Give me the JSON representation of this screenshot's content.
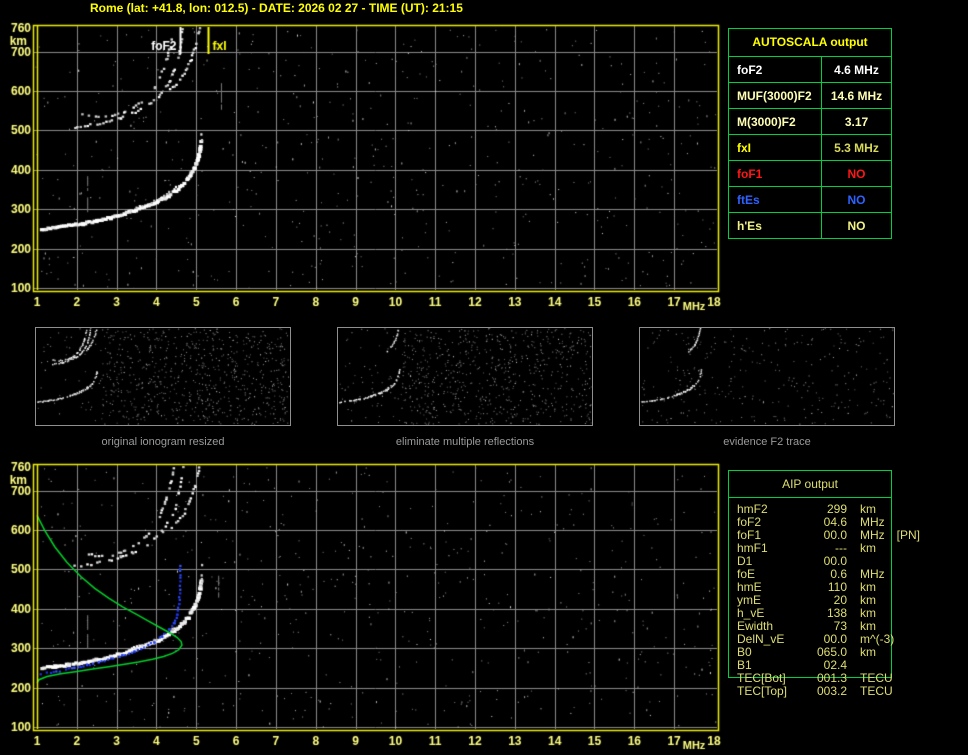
{
  "title": "Rome (lat: +41.8, lon: 012.5) - DATE: 2026 02 27 - TIME (UT): 21:15",
  "colors": {
    "background": "#000000",
    "title_yellow": "#ffff00",
    "axis_yellow": "#ffff80",
    "plot_border_yellow": "#f0f000",
    "grid_gray": "#8a8a8a",
    "table_border_green": "#00d040",
    "profile_green": "#00d22a",
    "trace_white": "#ffffff",
    "blue_points": "#2945ff",
    "caption_gray": "#9a9a9a",
    "aip_text": "#dede72"
  },
  "autoscala": {
    "header": "AUTOSCALA output",
    "rows": [
      {
        "label": "foF2",
        "value": "4.6 MHz",
        "color": "#ffffff",
        "value_color": "#ffffff"
      },
      {
        "label": "MUF(3000)F2",
        "value": "14.6 MHz",
        "color": "#ffffb4",
        "value_color": "#ffffb4"
      },
      {
        "label": "M(3000)F2",
        "value": "3.17",
        "color": "#ffffb4",
        "value_color": "#ffffb4"
      },
      {
        "label": "fxI",
        "value": "5.3 MHz",
        "color": "#ffff00",
        "value_color": "#d9d95a"
      },
      {
        "label": "foF1",
        "value": "NO",
        "color": "#ff1616",
        "value_color": "#ff1616"
      },
      {
        "label": "ftEs",
        "value": "NO",
        "color": "#2e62ff",
        "value_color": "#2e62ff"
      },
      {
        "label": "h'Es",
        "value": "NO",
        "color": "#f2f286",
        "value_color": "#f2f286"
      }
    ]
  },
  "aip": {
    "header": "AIP output",
    "rows": [
      {
        "label": "hmF2",
        "value": "299",
        "unit": "km",
        "note": ""
      },
      {
        "label": "foF2",
        "value": "04.6",
        "unit": "MHz",
        "note": ""
      },
      {
        "label": "foF1",
        "value": "00.0",
        "unit": "MHz",
        "note": "[PN]"
      },
      {
        "label": "hmF1",
        "value": "---",
        "unit": "km",
        "note": ""
      },
      {
        "label": "D1",
        "value": "00.0",
        "unit": "",
        "note": ""
      },
      {
        "label": "foE",
        "value": "0.6",
        "unit": "MHz",
        "note": ""
      },
      {
        "label": "hmE",
        "value": "110",
        "unit": "km",
        "note": ""
      },
      {
        "label": "ymE",
        "value": "20",
        "unit": "km",
        "note": ""
      },
      {
        "label": "h_vE",
        "value": "138",
        "unit": "km",
        "note": ""
      },
      {
        "label": "Ewidth",
        "value": "73",
        "unit": "km",
        "note": ""
      },
      {
        "label": "DelN_vE",
        "value": "00.0",
        "unit": "m^(-3)",
        "note": ""
      },
      {
        "label": "B0",
        "value": "065.0",
        "unit": "km",
        "note": ""
      },
      {
        "label": "B1",
        "value": "02.4",
        "unit": "",
        "note": ""
      },
      {
        "label": "TEC[Bot]",
        "value": "001.3",
        "unit": "TECU",
        "note": ""
      },
      {
        "label": "TEC[Top]",
        "value": "003.2",
        "unit": "TECU",
        "note": ""
      }
    ]
  },
  "captions": [
    "original ionogram resized",
    "eliminate multiple reflections",
    "evidence F2 trace"
  ],
  "chart_data": [
    {
      "id": "top-ionogram",
      "type": "scatter",
      "xlabel": "MHz",
      "ylabel": "km",
      "xlim": [
        1,
        18
      ],
      "ylim": [
        100,
        760
      ],
      "x_ticks": [
        1,
        2,
        3,
        4,
        5,
        6,
        7,
        8,
        9,
        10,
        11,
        12,
        13,
        14,
        15,
        16,
        17,
        18
      ],
      "y_ticks": [
        760,
        700,
        600,
        500,
        400,
        300,
        200,
        100
      ],
      "grid": true,
      "markers": [
        {
          "name": "foF2",
          "x": 4.6,
          "color": "#ffffff"
        },
        {
          "name": "fxI",
          "x": 5.3,
          "color": "#ffff00"
        }
      ],
      "series": [
        {
          "name": "F2-trace-ordinary",
          "points": [
            [
              1.12,
              249
            ],
            [
              1.45,
              253
            ],
            [
              1.8,
              258
            ],
            [
              2.15,
              263
            ],
            [
              2.5,
              270
            ],
            [
              2.85,
              278
            ],
            [
              3.2,
              288
            ],
            [
              3.5,
              298
            ],
            [
              3.8,
              309
            ],
            [
              4.05,
              320
            ],
            [
              4.3,
              333
            ],
            [
              4.5,
              347
            ],
            [
              4.65,
              360
            ],
            [
              4.8,
              378
            ],
            [
              4.95,
              402
            ],
            [
              5.05,
              428
            ],
            [
              5.1,
              452
            ],
            [
              5.13,
              470
            ]
          ]
        },
        {
          "name": "F2-trace-asymptote-faint",
          "points": [
            [
              5.13,
              470
            ],
            [
              5.15,
              512
            ]
          ]
        },
        {
          "name": "F2-trace-extraordinary",
          "points": [
            [
              3.3,
              296
            ],
            [
              3.65,
              308
            ],
            [
              3.95,
              320
            ],
            [
              4.2,
              333
            ],
            [
              4.4,
              347
            ],
            [
              4.55,
              360
            ]
          ]
        },
        {
          "name": "second-hop-a",
          "points": [
            [
              1.95,
              507
            ],
            [
              2.35,
              513
            ],
            [
              2.75,
              521
            ],
            [
              3.1,
              531
            ],
            [
              3.4,
              543
            ],
            [
              3.7,
              558
            ],
            [
              3.95,
              576
            ],
            [
              4.15,
              597
            ],
            [
              4.33,
              624
            ],
            [
              4.47,
              656
            ],
            [
              4.57,
              694
            ],
            [
              4.63,
              730
            ],
            [
              4.67,
              758
            ]
          ]
        },
        {
          "name": "second-hop-b",
          "points": [
            [
              2.15,
              541
            ],
            [
              2.55,
              535
            ],
            [
              2.9,
              537
            ],
            [
              3.2,
              546
            ],
            [
              3.5,
              562
            ],
            [
              3.75,
              584
            ],
            [
              3.95,
              610
            ],
            [
              4.12,
              642
            ],
            [
              4.26,
              680
            ],
            [
              4.37,
              722
            ],
            [
              4.44,
              757
            ]
          ]
        },
        {
          "name": "second-hop-x",
          "points": [
            [
              4.3,
              598
            ],
            [
              4.5,
              618
            ],
            [
              4.7,
              644
            ],
            [
              4.85,
              674
            ],
            [
              4.97,
              710
            ],
            [
              5.05,
              744
            ],
            [
              5.08,
              758
            ]
          ]
        }
      ],
      "noise": {
        "count": 580,
        "seed": 11,
        "streaks": [
          [
            2.26,
            300,
            385
          ],
          [
            5.62,
            560,
            620
          ]
        ]
      }
    },
    {
      "id": "bottom-ionogram",
      "type": "scatter",
      "xlabel": "MHz",
      "ylabel": "km",
      "xlim": [
        1,
        18
      ],
      "ylim": [
        100,
        760
      ],
      "x_ticks": [
        1,
        2,
        3,
        4,
        5,
        6,
        7,
        8,
        9,
        10,
        11,
        12,
        13,
        14,
        15,
        16,
        17,
        18
      ],
      "y_ticks": [
        760,
        700,
        600,
        500,
        400,
        300,
        200,
        100
      ],
      "grid": true,
      "markers": [],
      "series": [
        {
          "name": "F2-trace-ordinary",
          "points": [
            [
              1.12,
              249
            ],
            [
              1.45,
              253
            ],
            [
              1.8,
              258
            ],
            [
              2.15,
              263
            ],
            [
              2.5,
              270
            ],
            [
              2.85,
              278
            ],
            [
              3.2,
              288
            ],
            [
              3.5,
              298
            ],
            [
              3.8,
              309
            ],
            [
              4.05,
              320
            ],
            [
              4.3,
              333
            ],
            [
              4.5,
              347
            ],
            [
              4.65,
              360
            ],
            [
              4.8,
              378
            ],
            [
              4.95,
              402
            ],
            [
              5.05,
              428
            ],
            [
              5.1,
              452
            ],
            [
              5.13,
              470
            ]
          ]
        },
        {
          "name": "F2-trace-asymptote-faint",
          "points": [
            [
              5.13,
              470
            ],
            [
              5.15,
              512
            ]
          ]
        },
        {
          "name": "F2-trace-extraordinary",
          "points": [
            [
              3.3,
              296
            ],
            [
              3.65,
              308
            ],
            [
              3.95,
              320
            ],
            [
              4.2,
              333
            ],
            [
              4.4,
              347
            ],
            [
              4.55,
              360
            ]
          ]
        },
        {
          "name": "second-hop-a",
          "points": [
            [
              1.95,
              507
            ],
            [
              2.35,
              513
            ],
            [
              2.75,
              521
            ],
            [
              3.1,
              531
            ],
            [
              3.4,
              543
            ],
            [
              3.7,
              558
            ],
            [
              3.95,
              576
            ],
            [
              4.15,
              597
            ],
            [
              4.33,
              624
            ],
            [
              4.47,
              656
            ],
            [
              4.57,
              694
            ],
            [
              4.63,
              730
            ],
            [
              4.67,
              758
            ]
          ]
        },
        {
          "name": "second-hop-b",
          "points": [
            [
              2.15,
              541
            ],
            [
              2.55,
              535
            ],
            [
              2.9,
              537
            ],
            [
              3.2,
              546
            ],
            [
              3.5,
              562
            ],
            [
              3.75,
              584
            ],
            [
              3.95,
              610
            ],
            [
              4.12,
              642
            ],
            [
              4.26,
              680
            ],
            [
              4.37,
              722
            ],
            [
              4.44,
              757
            ]
          ]
        },
        {
          "name": "second-hop-x",
          "points": [
            [
              4.3,
              598
            ],
            [
              4.5,
              618
            ],
            [
              4.7,
              644
            ],
            [
              4.85,
              674
            ],
            [
              4.97,
              710
            ],
            [
              5.05,
              744
            ],
            [
              5.08,
              758
            ]
          ]
        },
        {
          "name": "electron-density-profile",
          "color": "#00d22a",
          "points": [
            [
              1.0,
              637
            ],
            [
              1.2,
              598
            ],
            [
              1.45,
              557
            ],
            [
              1.75,
              518
            ],
            [
              2.1,
              482
            ],
            [
              2.45,
              452
            ],
            [
              2.8,
              427
            ],
            [
              3.15,
              405
            ],
            [
              3.5,
              386
            ],
            [
              3.8,
              369
            ],
            [
              4.1,
              352
            ],
            [
              4.35,
              338
            ],
            [
              4.52,
              327
            ],
            [
              4.62,
              317
            ],
            [
              4.64,
              308
            ],
            [
              4.56,
              296
            ],
            [
              4.4,
              287
            ],
            [
              4.18,
              279
            ],
            [
              3.9,
              272
            ],
            [
              3.55,
              265
            ],
            [
              3.2,
              259
            ],
            [
              2.8,
              253
            ],
            [
              2.4,
              247
            ],
            [
              2.0,
              241
            ],
            [
              1.6,
              235
            ],
            [
              1.25,
              228
            ],
            [
              1.05,
              220
            ],
            [
              1.0,
              212
            ]
          ]
        },
        {
          "name": "autoscaled-trace-points",
          "color": "#2945ff",
          "points": [
            [
              1.08,
              233
            ],
            [
              1.35,
              238
            ],
            [
              1.65,
              244
            ],
            [
              1.95,
              250
            ],
            [
              2.25,
              257
            ],
            [
              2.55,
              264
            ],
            [
              2.85,
              272
            ],
            [
              3.15,
              281
            ],
            [
              3.45,
              292
            ],
            [
              3.7,
              303
            ],
            [
              3.95,
              316
            ],
            [
              4.15,
              330
            ],
            [
              4.32,
              346
            ],
            [
              4.45,
              364
            ],
            [
              4.53,
              386
            ],
            [
              4.57,
              412
            ],
            [
              4.59,
              440
            ],
            [
              4.6,
              468
            ],
            [
              4.6,
              495
            ],
            [
              4.6,
              510
            ]
          ]
        }
      ],
      "noise": {
        "count": 580,
        "seed": 29,
        "streaks": [
          [
            2.26,
            300,
            385
          ],
          [
            5.55,
            430,
            490
          ]
        ]
      }
    }
  ]
}
